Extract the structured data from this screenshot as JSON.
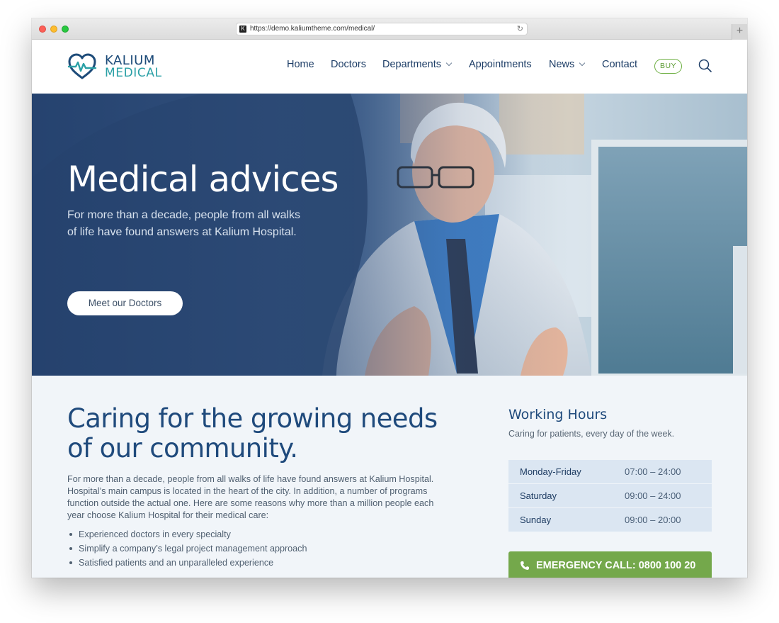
{
  "browser": {
    "url": "https://demo.kaliumtheme.com/medical/",
    "favicon": "K",
    "reload_icon": "↻",
    "new_tab_icon": "+"
  },
  "logo": {
    "line1": "KALIUM",
    "line2": "MEDICAL",
    "icon": "heart-pulse-icon",
    "colors": {
      "primary": "#1d4b79",
      "accent": "#2aa0a6"
    }
  },
  "nav": {
    "items": [
      {
        "label": "Home"
      },
      {
        "label": "Doctors"
      },
      {
        "label": "Departments"
      },
      {
        "label": "Appointments"
      },
      {
        "label": "News"
      },
      {
        "label": "Contact"
      }
    ],
    "buy_label": "BUY"
  },
  "hero": {
    "title": "Medical advices",
    "subtitle": "For more than a decade, people from all walks of life have found answers at Kalium Hospital.",
    "button_label": "Meet our Doctors"
  },
  "intro": {
    "title": "Caring for the growing needs of our community.",
    "paragraph": "For more than a decade, people from all walks of life have found answers at Kalium Hospital. Hospital’s main campus is located in the heart of the city. In addition, a number of programs function outside the actual one. Here are some reasons why more than a million people each year choose Kalium Hospital for their medical care:",
    "reasons": [
      "Experienced doctors in every specialty",
      "Simplify a company’s legal project management approach",
      "Satisfied patients and an unparalleled experience"
    ]
  },
  "working_hours": {
    "title": "Working Hours",
    "subtitle": "Caring for patients, every day of the week.",
    "rows": [
      {
        "day": "Monday-Friday",
        "time": "07:00 – 24:00"
      },
      {
        "day": "Saturday",
        "time": "09:00 – 24:00"
      },
      {
        "day": "Sunday",
        "time": "09:00 – 20:00"
      }
    ],
    "emergency_label": "EMERGENCY CALL: 0800 100 20"
  },
  "colors": {
    "brand_blue": "#1f4a7c",
    "teal": "#2aa0a6",
    "green": "#74a84b",
    "hours_row_bg": "#dbe6f2",
    "content_bg": "#f1f5f9"
  }
}
